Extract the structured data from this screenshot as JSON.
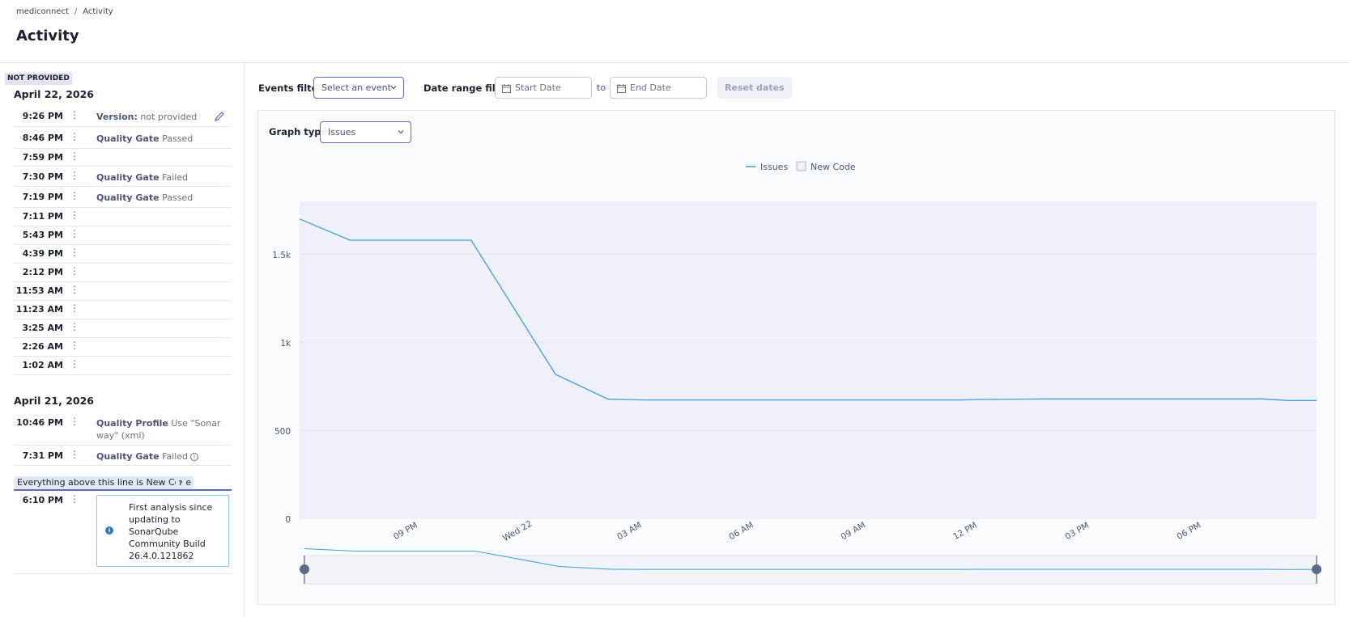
{
  "breadcrumb": {
    "project": "mediconnect",
    "separator": "/",
    "current": "Activity"
  },
  "page_title": "Activity",
  "sidebar": {
    "badge": "NOT PROVIDED",
    "groups": [
      {
        "date": "April 22, 2026",
        "events": [
          {
            "time": "9:26 PM",
            "label": "Version:",
            "detail": "not provided"
          },
          {
            "time": "8:46 PM",
            "label": "Quality Gate",
            "detail": "Passed"
          },
          {
            "time": "7:59 PM",
            "label": "",
            "detail": ""
          },
          {
            "time": "7:30 PM",
            "label": "Quality Gate",
            "detail": "Failed"
          },
          {
            "time": "7:19 PM",
            "label": "Quality Gate",
            "detail": "Passed"
          },
          {
            "time": "7:11 PM",
            "label": "",
            "detail": ""
          },
          {
            "time": "5:43 PM",
            "label": "",
            "detail": ""
          },
          {
            "time": "4:39 PM",
            "label": "",
            "detail": ""
          },
          {
            "time": "2:12 PM",
            "label": "",
            "detail": ""
          },
          {
            "time": "11:53 AM",
            "label": "",
            "detail": ""
          },
          {
            "time": "11:23 AM",
            "label": "",
            "detail": ""
          },
          {
            "time": "3:25 AM",
            "label": "",
            "detail": ""
          },
          {
            "time": "2:26 AM",
            "label": "",
            "detail": ""
          },
          {
            "time": "1:02 AM",
            "label": "",
            "detail": ""
          }
        ]
      },
      {
        "date": "April 21, 2026",
        "events": [
          {
            "time": "10:46 PM",
            "label": "Quality Profile",
            "detail": "Use \"Sonar way\" (xml)"
          },
          {
            "time": "7:31 PM",
            "label": "Quality Gate",
            "detail": "Failed"
          },
          {
            "time": "6:10 PM",
            "label": "",
            "detail": ""
          }
        ]
      }
    ],
    "new_code_label": "Everything above this line is New Code",
    "new_code_help": "?",
    "info_box": "First analysis since updating to SonarQube Community Build 26.4.0.121862",
    "menu_glyph": "⋮",
    "info_glyph": "i"
  },
  "filters": {
    "events_label": "Events filter",
    "events_value": "Select an event",
    "date_range_label": "Date range filter",
    "start_placeholder": "Start Date",
    "to": "to",
    "end_placeholder": "End Date",
    "reset": "Reset dates"
  },
  "graph": {
    "type_label": "Graph type",
    "type_value": "Issues"
  },
  "colors": {
    "line": "#3e9fd4",
    "plot_bg": "#eff0fa",
    "accent": "#5e6cb8"
  },
  "chart_data": {
    "type": "line",
    "legend": [
      "Issues",
      "New Code"
    ],
    "ylabel": "",
    "xlabel": "",
    "yticks": [
      "0",
      "500",
      "1k",
      "1.5k"
    ],
    "ylim": [
      0,
      1800
    ],
    "xticks": [
      "09 PM",
      "Wed 22",
      "03 AM",
      "06 AM",
      "09 AM",
      "12 PM",
      "03 PM",
      "06 PM"
    ],
    "xtick_hours": [
      21,
      24,
      27,
      30,
      33,
      36,
      39,
      42
    ],
    "xlim_hours": [
      18.17,
      45.43
    ],
    "series": [
      {
        "name": "Issues",
        "points": [
          {
            "hour": 18.17,
            "value": 1700
          },
          {
            "hour": 19.52,
            "value": 1580
          },
          {
            "hour": 22.77,
            "value": 1580
          },
          {
            "hour": 25.03,
            "value": 820
          },
          {
            "hour": 26.43,
            "value": 680
          },
          {
            "hour": 27.42,
            "value": 675
          },
          {
            "hour": 35.88,
            "value": 675
          },
          {
            "hour": 36.38,
            "value": 678
          },
          {
            "hour": 38.2,
            "value": 681
          },
          {
            "hour": 43.98,
            "value": 681
          },
          {
            "hour": 44.67,
            "value": 672
          },
          {
            "hour": 45.43,
            "value": 672
          }
        ]
      }
    ],
    "grid": true,
    "legend_position": "top-center"
  }
}
